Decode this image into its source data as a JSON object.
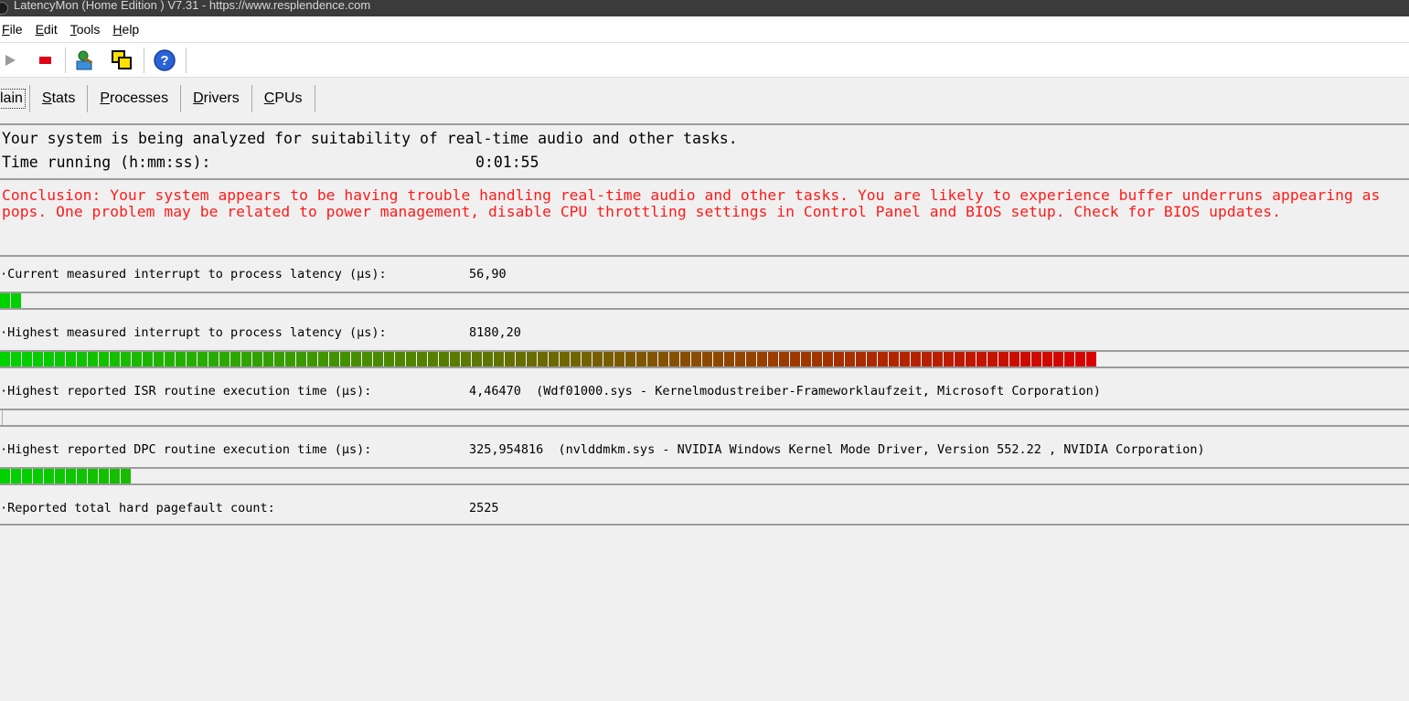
{
  "window": {
    "title": "LatencyMon  (Home Edition )  V7.31 - https://www.resplendence.com"
  },
  "menu": {
    "items": [
      {
        "acc": "F",
        "rest": "ile",
        "label": "File"
      },
      {
        "acc": "E",
        "rest": "dit",
        "label": "Edit"
      },
      {
        "acc": "T",
        "rest": "ools",
        "label": "Tools"
      },
      {
        "acc": "H",
        "rest": "elp",
        "label": "Help"
      }
    ]
  },
  "toolbar": {
    "icons": [
      "play-icon",
      "stop-icon",
      "driver-icon",
      "window-icon",
      "help-icon"
    ]
  },
  "tabs": [
    {
      "pre": "",
      "acc": "",
      "rest": "lain",
      "label": "Main"
    },
    {
      "pre": "",
      "acc": "S",
      "rest": "tats",
      "label": "Stats"
    },
    {
      "pre": "",
      "acc": "P",
      "rest": "rocesses",
      "label": "Processes"
    },
    {
      "pre": "",
      "acc": "D",
      "rest": "rivers",
      "label": "Drivers"
    },
    {
      "pre": "",
      "acc": "C",
      "rest": "PUs",
      "label": "CPUs"
    }
  ],
  "status": {
    "analyzing_text": "Your system is being analyzed for suitability of real-time audio and other tasks.",
    "time_label": "Time running (h:mm:ss):",
    "time_value": "0:01:55"
  },
  "conclusion": {
    "text": "Conclusion: Your system appears to be having trouble handling real-time audio and other tasks. You are likely to experience buffer underruns appearing as pops. One problem may be related to power management, disable CPU throttling settings in Control Panel and BIOS setup. Check for BIOS updates."
  },
  "colors": {
    "conclusion": "#ff1a1a",
    "bar_low": "#00d200",
    "bar_high": "#d80000"
  },
  "metrics": [
    {
      "label": "·Current measured interrupt to process latency (µs):",
      "value": "56,90",
      "bar_segments": 2
    },
    {
      "label": "·Highest measured interrupt to process latency (µs):",
      "value": "8180,20",
      "bar_segments": 100
    },
    {
      "label": "·Highest reported ISR routine execution time (µs):",
      "value": "4,46470  (Wdf01000.sys - Kernelmodustreiber-Frameworklaufzeit, Microsoft Corporation)",
      "bar_segments": 0
    },
    {
      "label": "·Highest reported DPC routine execution time (µs):",
      "value": "325,954816  (nvlddmkm.sys - NVIDIA Windows Kernel Mode Driver, Version 552.22 , NVIDIA Corporation)",
      "bar_segments": 12
    },
    {
      "label": "·Reported total hard pagefault count:",
      "value": "2525",
      "bar_segments": null
    }
  ]
}
